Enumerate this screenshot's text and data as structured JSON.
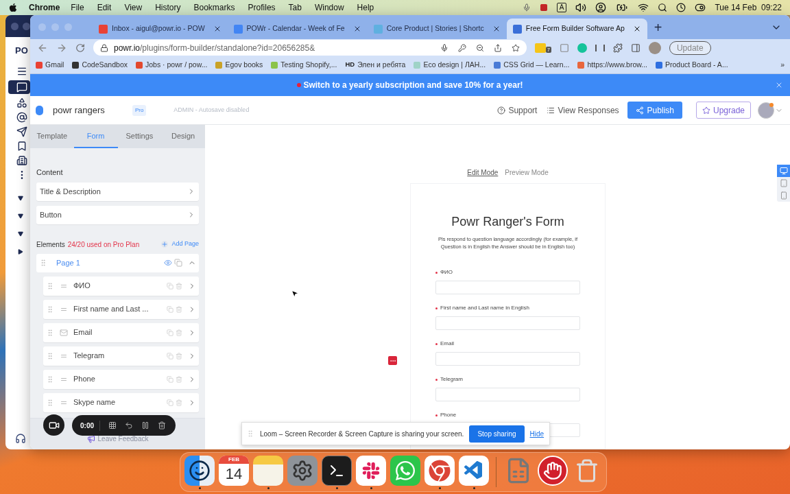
{
  "menu_bar": {
    "app": "Chrome",
    "menus": [
      "File",
      "Edit",
      "View",
      "History",
      "Bookmarks",
      "Profiles",
      "Tab",
      "Window",
      "Help"
    ],
    "input_source": "A",
    "clock": "Tue 14 Feb  09:22"
  },
  "background_window": {
    "logo_text": "PO"
  },
  "browser": {
    "tabs": [
      {
        "title": "Inbox - aigul@powr.io - POW",
        "color": "#e94235",
        "selected": false
      },
      {
        "title": "POWr - Calendar - Week of Fe",
        "color": "#4285f4",
        "selected": false
      },
      {
        "title": "Core Product | Stories | Shortc",
        "color": "#5fb0e0",
        "selected": false
      },
      {
        "title": "Free Form Builder Software Ap",
        "color": "#3b6fd8",
        "selected": true
      }
    ],
    "new_tab": "+",
    "url_host": "powr.io",
    "url_path": "/plugins/form-builder/standalone?id=20656285&",
    "extension_badge": "7",
    "update_button": "Update",
    "bookmarks": [
      {
        "label": "Gmail",
        "color": "#e94235"
      },
      {
        "label": "CodeSandbox",
        "color": "#333333"
      },
      {
        "label": "Jobs · powr / pow...",
        "color": "#e2492f"
      },
      {
        "label": "Egov books",
        "color": "#c9a227"
      },
      {
        "label": "Testing Shopify,...",
        "color": "#8bc34a"
      },
      {
        "label": "Элен и ребята",
        "icon_text": "HD",
        "color": "#222222"
      },
      {
        "label": "Eco design | ЛАН...",
        "color": "#9fd3c7"
      },
      {
        "label": "CSS Grid — Learn...",
        "color": "#4a7bd6"
      },
      {
        "label": "https://www.brow...",
        "color": "#e8663d"
      },
      {
        "label": "Product Board - A...",
        "color": "#2f6fe0"
      }
    ],
    "bookmarks_more": "»"
  },
  "banner": {
    "text": "Switch to a yearly subscription and save 10% for a year!"
  },
  "header": {
    "project": "powr rangers",
    "plan_badge": "Pro",
    "status": "ADMIN - Autosave disabled",
    "support": "Support",
    "view_responses": "View Responses",
    "publish": "Publish",
    "upgrade": "Upgrade"
  },
  "sidebar": {
    "tabs": [
      {
        "label": "Template",
        "selected": false
      },
      {
        "label": "Form",
        "selected": true
      },
      {
        "label": "Settings",
        "selected": false
      },
      {
        "label": "Design",
        "selected": false
      }
    ],
    "content_heading": "Content",
    "content_items": [
      "Title & Description",
      "Button"
    ],
    "elements_heading": "Elements",
    "elements_usage": "24/20 used on Pro Plan",
    "add_page": "Add Page",
    "page": {
      "title": "Page 1",
      "expanded": true,
      "elements": [
        {
          "label": "ФИО",
          "kind": "text"
        },
        {
          "label": "First name and Last ...",
          "kind": "text"
        },
        {
          "label": "Email",
          "kind": "email"
        },
        {
          "label": "Telegram",
          "kind": "text"
        },
        {
          "label": "Phone",
          "kind": "text"
        },
        {
          "label": "Skype name",
          "kind": "text"
        }
      ]
    },
    "feedback": "Leave Feedback"
  },
  "recorder": {
    "timer": "0:00"
  },
  "canvas": {
    "modes": [
      {
        "label": "Edit Mode",
        "selected": true
      },
      {
        "label": "Preview Mode",
        "selected": false
      }
    ],
    "devices": [
      {
        "kind": "desktop",
        "selected": true
      },
      {
        "kind": "tablet",
        "selected": false
      },
      {
        "kind": "phone",
        "selected": false
      }
    ],
    "form": {
      "title": "Powr Ranger's Form",
      "description": "Pls respond to question language accordingly (for example, if Question is in English the Answer should be in English too)",
      "fields": [
        {
          "label": "ФИО",
          "required": true
        },
        {
          "label": "First name and Last name in English",
          "required": true
        },
        {
          "label": "Email",
          "required": true
        },
        {
          "label": "Telegram",
          "required": true
        },
        {
          "label": "Phone",
          "required": true
        }
      ]
    }
  },
  "sharing_bar": {
    "message": "Loom – Screen Recorder & Screen Capture is sharing your screen.",
    "stop": "Stop sharing",
    "hide": "Hide"
  },
  "dock": {
    "apps": [
      {
        "kind": "finder",
        "running": true
      },
      {
        "kind": "calendar",
        "month": "FEB",
        "day": "14",
        "running": false
      },
      {
        "kind": "notes",
        "running": true
      },
      {
        "kind": "settings",
        "running": false
      },
      {
        "kind": "terminal",
        "running": true
      },
      {
        "kind": "slack",
        "running": true
      },
      {
        "kind": "whatsapp",
        "running": false
      },
      {
        "kind": "chrome",
        "running": true
      },
      {
        "kind": "vscode",
        "running": true
      },
      {
        "kind": "separator"
      },
      {
        "kind": "file",
        "running": false
      },
      {
        "kind": "blocker",
        "running": false
      },
      {
        "kind": "trash",
        "running": false
      }
    ]
  }
}
